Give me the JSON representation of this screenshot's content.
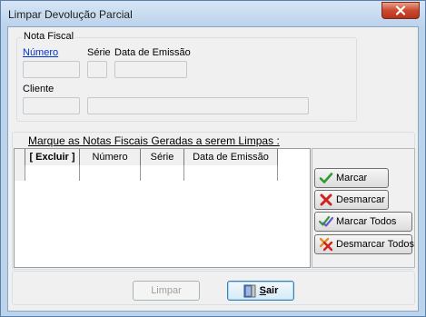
{
  "window": {
    "title": "Limpar Devolução Parcial"
  },
  "nota_fiscal": {
    "group_title": "Nota Fiscal",
    "numero_label": "Número",
    "serie_label": "Série",
    "data_emissao_label": "Data de Emissão",
    "cliente_label": "Cliente",
    "numero_value": "",
    "serie_value": "",
    "data_emissao_value": "",
    "cliente_code_value": "",
    "cliente_name_value": ""
  },
  "notas_geradas": {
    "group_title": "Marque  as Notas Fiscais Geradas a serem Limpas :",
    "columns": [
      "[ Excluir ]",
      "Número",
      "Série",
      "Data de Emissão"
    ]
  },
  "actions": {
    "marcar": "Marcar",
    "desmarcar": "Desmarcar",
    "marcar_todos": "Marcar Todos",
    "desmarcar_todos": "Desmarcar Todos"
  },
  "footer": {
    "limpar": "Limpar",
    "sair": "Sair",
    "sair_accelerator": "S",
    "sair_rest": "air"
  }
}
